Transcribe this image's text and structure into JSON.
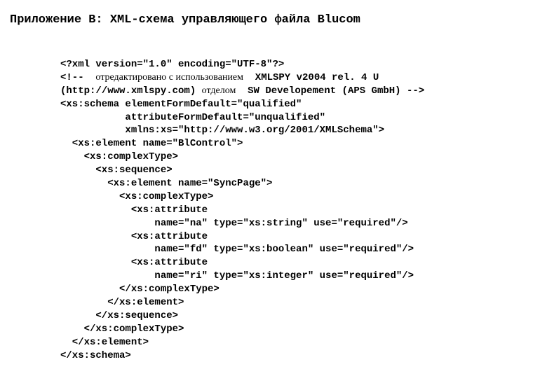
{
  "heading": "Приложение B: XML-схема управляющего файла Blucom",
  "code": {
    "l1": "<?xml version=\"1.0\" encoding=\"UTF-8\"?>",
    "l2a": "<!--  ",
    "l2b": "отредактировано с использованием",
    "l2c": "  XMLSPY v2004 rel. 4 U",
    "l3a": "(http://www.xmlspy.com) ",
    "l3b": "отделом",
    "l3c": "  SW Developement (APS GmbH) -->",
    "l4": "<xs:schema elementFormDefault=\"qualified\"",
    "l5": "           attributeFormDefault=\"unqualified\"",
    "l6": "           xmlns:xs=\"http://www.w3.org/2001/XMLSchema\">",
    "l7": "  <xs:element name=\"BlControl\">",
    "l8": "    <xs:complexType>",
    "l9": "      <xs:sequence>",
    "l10": "        <xs:element name=\"SyncPage\">",
    "l11": "          <xs:complexType>",
    "l12": "            <xs:attribute",
    "l13": "                name=\"na\" type=\"xs:string\" use=\"required\"/>",
    "l14": "            <xs:attribute",
    "l15": "                name=\"fd\" type=\"xs:boolean\" use=\"required\"/>",
    "l16": "            <xs:attribute",
    "l17": "                name=\"ri\" type=\"xs:integer\" use=\"required\"/>",
    "l18": "          </xs:complexType>",
    "l19": "        </xs:element>",
    "l20": "      </xs:sequence>",
    "l21": "    </xs:complexType>",
    "l22": "  </xs:element>",
    "l23": "</xs:schema>"
  }
}
